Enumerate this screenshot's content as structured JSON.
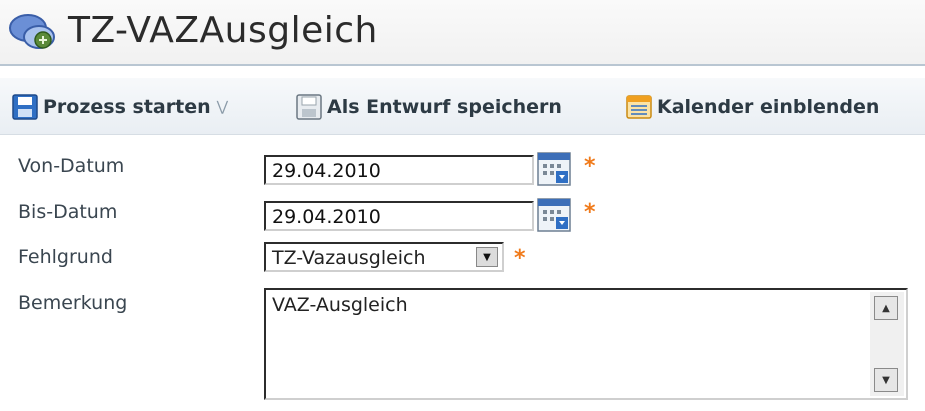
{
  "page": {
    "title": "TZ-VAZAusgleich"
  },
  "toolbar": {
    "start_process_label": "Prozess starten",
    "save_draft_label": "Als Entwurf speichern",
    "show_calendar_label": "Kalender einblenden"
  },
  "form": {
    "from_date": {
      "label": "Von-Datum",
      "value": "29.04.2010",
      "required_marker": "*"
    },
    "to_date": {
      "label": "Bis-Datum",
      "value": "29.04.2010",
      "required_marker": "*"
    },
    "reason": {
      "label": "Fehlgrund",
      "value": "TZ-Vazausgleich",
      "required_marker": "*"
    },
    "remark": {
      "label": "Bemerkung",
      "value": "VAZ-Ausgleich"
    }
  },
  "colors": {
    "required": "#f07a1a",
    "toolbar_text": "#2d3a44",
    "accent_blue": "#2f6fc4"
  },
  "icons": [
    "chat-bubbles-icon",
    "save-icon",
    "dropdown-chevrons-icon",
    "save-draft-icon",
    "calendar-icon",
    "date-picker-icon"
  ]
}
